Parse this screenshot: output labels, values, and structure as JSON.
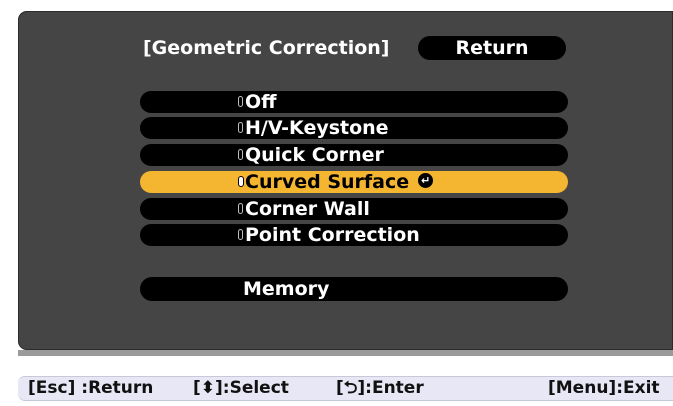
{
  "menu": {
    "title": "[Geometric Correction]",
    "return_label": "Return",
    "items": [
      {
        "label": "Off",
        "selected": false
      },
      {
        "label": "H/V-Keystone",
        "selected": false
      },
      {
        "label": "Quick Corner",
        "selected": false
      },
      {
        "label": "Curved Surface",
        "selected": true
      },
      {
        "label": "Corner Wall",
        "selected": false
      },
      {
        "label": "Point Correction",
        "selected": false
      }
    ],
    "memory_label": "Memory",
    "enter_icon": "enter-icon"
  },
  "helpbar": {
    "esc": "[Esc] :Return",
    "select": "[⬍]:Select",
    "enter": "[⮌]:Enter",
    "menu": "[Menu]:Exit"
  },
  "colors": {
    "panel": "#454545",
    "pill": "#000000",
    "highlight": "#f4b531",
    "helpbar": "#e7e7f6"
  }
}
